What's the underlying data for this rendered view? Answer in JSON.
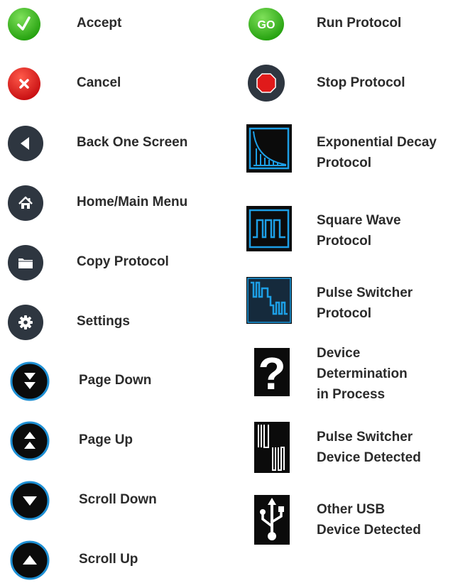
{
  "colors": {
    "green": "#39b51c",
    "red": "#d81c1c",
    "dark_button": "#2e3640",
    "blue_ring": "#1e8fd3",
    "black": "#0b0b0b",
    "protocol_blue": "#1d9fe6",
    "label_text": "#2b2b2b"
  },
  "left": [
    {
      "icon": "checkmark-icon",
      "label": "Accept"
    },
    {
      "icon": "x-icon",
      "label": "Cancel"
    },
    {
      "icon": "back-arrow-icon",
      "label": "Back One Screen"
    },
    {
      "icon": "home-icon",
      "label": "Home/Main Menu"
    },
    {
      "icon": "folder-icon",
      "label": "Copy Protocol"
    },
    {
      "icon": "gear-icon",
      "label": "Settings"
    },
    {
      "icon": "page-down-icon",
      "label": "Page Down"
    },
    {
      "icon": "page-up-icon",
      "label": "Page Up"
    },
    {
      "icon": "scroll-down-icon",
      "label": "Scroll Down"
    },
    {
      "icon": "scroll-up-icon",
      "label": "Scroll Up"
    }
  ],
  "right": [
    {
      "icon": "go-icon",
      "icon_text": "GO",
      "label": [
        "Run Protocol"
      ]
    },
    {
      "icon": "stop-sign-icon",
      "label": [
        "Stop Protocol"
      ]
    },
    {
      "icon": "exponential-decay-icon",
      "label": [
        "Exponential Decay",
        "Protocol"
      ]
    },
    {
      "icon": "square-wave-icon",
      "label": [
        "Square Wave",
        "Protocol"
      ]
    },
    {
      "icon": "pulse-switcher-icon",
      "label": [
        "Pulse Switcher",
        "Protocol"
      ]
    },
    {
      "icon": "question-mark-icon",
      "icon_text": "?",
      "label": [
        "Device",
        "Determination",
        "in Process"
      ]
    },
    {
      "icon": "pulse-switcher-device-icon",
      "label": [
        "Pulse Switcher",
        "Device Detected"
      ]
    },
    {
      "icon": "usb-icon",
      "label": [
        "Other USB",
        "Device Detected"
      ]
    }
  ]
}
